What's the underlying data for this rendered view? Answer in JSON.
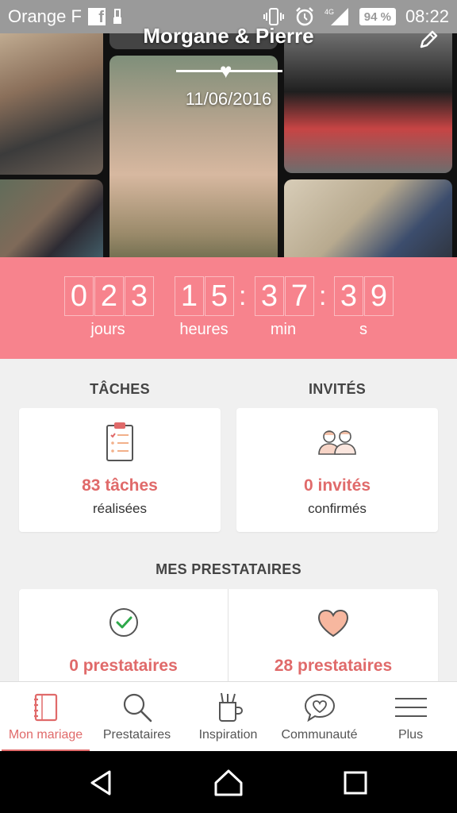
{
  "status_bar": {
    "carrier": "Orange F",
    "battery": "94 %",
    "time": "08:22"
  },
  "header": {
    "couple_name": "Morgane & Pierre",
    "date": "11/06/2016"
  },
  "countdown": {
    "days_digits": [
      "0",
      "2",
      "3"
    ],
    "hours_digits": [
      "1",
      "5"
    ],
    "minutes_digits": [
      "3",
      "7"
    ],
    "seconds_digits": [
      "3",
      "9"
    ],
    "separator": ":",
    "days_label": "jours",
    "hours_label": "heures",
    "minutes_label": "min",
    "seconds_label": "s"
  },
  "tasks": {
    "title": "TÂCHES",
    "count": "83 tâches",
    "sub": "réalisées"
  },
  "guests": {
    "title": "INVITÉS",
    "count": "0 invités",
    "sub": "confirmés"
  },
  "vendors": {
    "title": "MES PRESTATAIRES",
    "booked_count": "0 prestataires",
    "favorite_count": "28 prestataires"
  },
  "bottom_nav": {
    "items": [
      {
        "label": "Mon mariage",
        "icon": "notebook-icon",
        "active": true
      },
      {
        "label": "Prestataires",
        "icon": "search-icon",
        "active": false
      },
      {
        "label": "Inspiration",
        "icon": "inspiration-jar-icon",
        "active": false
      },
      {
        "label": "Communauté",
        "icon": "chat-heart-icon",
        "active": false
      },
      {
        "label": "Plus",
        "icon": "menu-icon",
        "active": false
      }
    ]
  },
  "colors": {
    "accent": "#e06a6a",
    "countdown_bg": "#f7838d"
  }
}
